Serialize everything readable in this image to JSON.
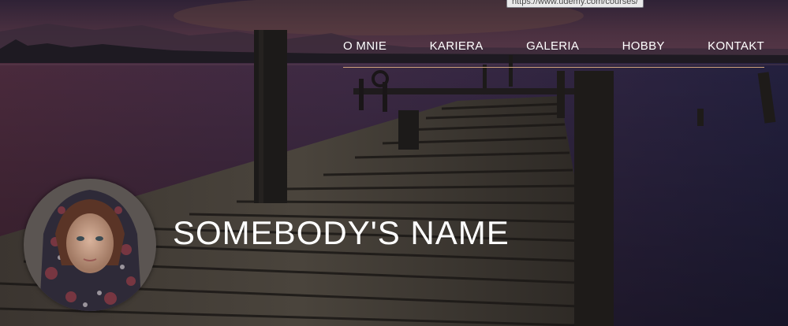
{
  "browser": {
    "status_url": "https://www.udemy.com/courses/"
  },
  "nav": {
    "items": [
      {
        "label": "O MNIE"
      },
      {
        "label": "KARIERA"
      },
      {
        "label": "GALERIA"
      },
      {
        "label": "HOBBY"
      },
      {
        "label": "KONTAKT"
      }
    ]
  },
  "profile": {
    "name": "SOMEBODY'S NAME"
  },
  "colors": {
    "nav_underline": "#cfa37a",
    "text": "#ffffff",
    "sky_top": "#3a2a48",
    "water": "#2a2140"
  }
}
